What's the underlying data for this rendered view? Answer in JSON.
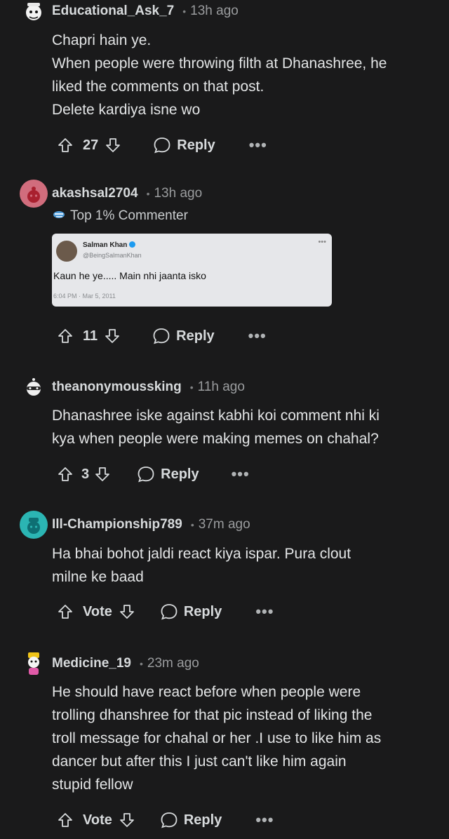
{
  "comments": [
    {
      "username": "Educational_Ask_7",
      "time": "13h ago",
      "lines": [
        "Chapri hain ye.",
        "When people were throwing filth at Dhanashree, he",
        "liked the comments on that post.",
        "Delete kardiya isne wo"
      ],
      "votes": "27",
      "reply": "Reply",
      "more": "•••"
    },
    {
      "username": "akashsal2704",
      "time": "13h ago",
      "flair": "Top 1% Commenter",
      "embed": {
        "name": "Salman Khan",
        "handle": "@BeingSalmanKhan",
        "text": "Kaun he ye..... Main nhi jaanta isko",
        "date": "6:04 PM · Mar 5, 2011",
        "more": "•••"
      },
      "votes": "11",
      "reply": "Reply",
      "more": "•••"
    },
    {
      "username": "theanonymoussking",
      "time": "11h ago",
      "lines": [
        "Dhanashree iske against kabhi koi comment nhi ki",
        "kya when people were making memes on chahal?"
      ],
      "votes": "3",
      "reply": "Reply",
      "more": "•••"
    },
    {
      "username": "Ill-Championship789",
      "time": "37m ago",
      "lines": [
        "Ha bhai bohot jaldi react kiya ispar. Pura clout",
        "milne ke baad"
      ],
      "votes": "Vote",
      "reply": "Reply",
      "more": "•••"
    },
    {
      "username": "Medicine_19",
      "time": "23m ago",
      "lines": [
        "He should have react before when people were",
        "trolling dhanshree for that pic instead of liking the",
        "troll message for chahal or her .I use to like him as",
        "dancer but after this I just can't like him again",
        "stupid fellow"
      ],
      "votes": "Vote",
      "reply": "Reply",
      "more": "•••"
    }
  ],
  "separator": "•",
  "colors": {
    "background": "#1a1a1b",
    "text": "#d7dadc",
    "muted": "#9a9c9e"
  }
}
